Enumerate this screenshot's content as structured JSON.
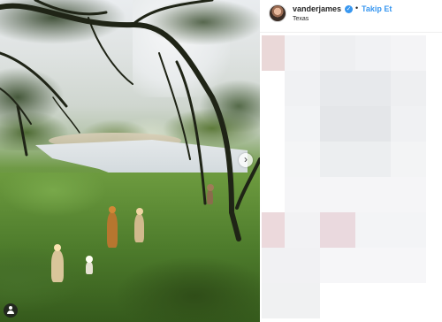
{
  "post": {
    "username": "vanderjames",
    "verified": true,
    "separator": "•",
    "follow_label": "Takip Et",
    "location": "Texas"
  },
  "icons": {
    "verified": "verified-badge-icon",
    "carousel_next": "chevron-right-icon",
    "tagged_users": "user-tag-icon"
  },
  "colors": {
    "link_blue": "#3897f0",
    "text": "#262626",
    "divider": "#efefef"
  },
  "carousel": {
    "next_glyph": "›"
  }
}
